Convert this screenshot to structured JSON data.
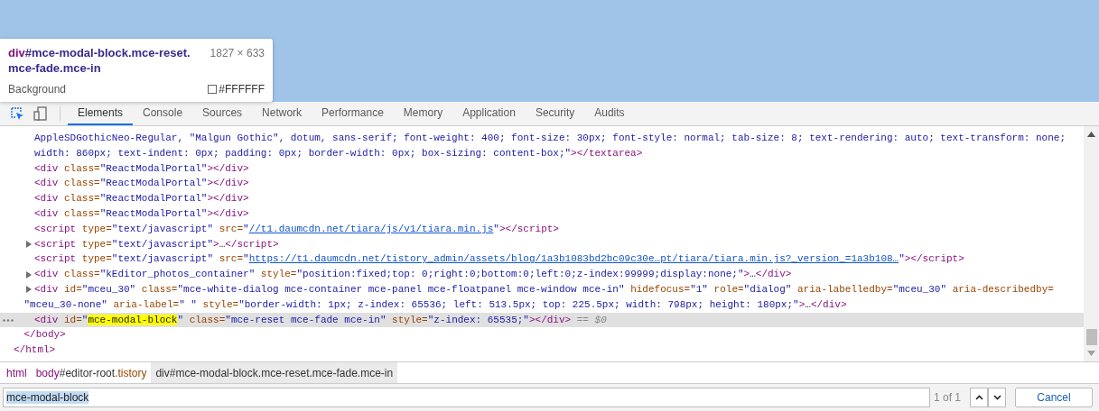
{
  "tooltip": {
    "title": [
      {
        "kind": "tag",
        "text": "div"
      },
      {
        "kind": "selector",
        "text": "#mce-modal-block.mce-reset."
      },
      {
        "kind": "break",
        "text": "mce-fade.mce-in"
      }
    ],
    "size": "1827 × 633",
    "property": "Background",
    "value": "#FFFFFF"
  },
  "toolbar": {
    "tools": [
      {
        "kind": "inspect",
        "selected": true
      },
      {
        "kind": "device",
        "selected": false
      }
    ],
    "tabs": [
      {
        "label": "Elements",
        "selected": true
      },
      {
        "label": "Console",
        "selected": false
      },
      {
        "label": "Sources",
        "selected": false
      },
      {
        "label": "Network",
        "selected": false
      },
      {
        "label": "Performance",
        "selected": false
      },
      {
        "label": "Memory",
        "selected": false
      },
      {
        "label": "Application",
        "selected": false
      },
      {
        "label": "Security",
        "selected": false
      },
      {
        "label": "Audits",
        "selected": false
      }
    ]
  },
  "dom_tree": {
    "children": [
      {
        "children": [
          {
            "kind": "leaf",
            "selected": false,
            "rows": [
              [
                {
                  "kind": "value",
                  "text": "AppleSDGothicNeo-Regular, \"Malgun Gothic\", dotum, sans-serif; font-weight: 400; font-size: 30px; font-style: normal; tab-size: 8; text-rendering: auto; text-transform: none;"
                }
              ],
              [
                {
                  "kind": "value",
                  "text": "width: 860px; text-indent: 0px; padding: 0px; border-width: 0px; box-sizing: content-box;\""
                },
                {
                  "kind": "tag",
                  "text": "></textarea>"
                }
              ]
            ]
          },
          {
            "kind": "leaf",
            "selected": false,
            "rows": [
              [
                {
                  "kind": "tag",
                  "text": "<div"
                },
                {
                  "kind": "attr",
                  "text": " class="
                },
                {
                  "kind": "value",
                  "text": "\"ReactModalPortal\""
                },
                {
                  "kind": "tag",
                  "text": "></div>"
                }
              ]
            ]
          },
          {
            "kind": "leaf",
            "selected": false,
            "rows": [
              [
                {
                  "kind": "tag",
                  "text": "<div"
                },
                {
                  "kind": "attr",
                  "text": " class="
                },
                {
                  "kind": "value",
                  "text": "\"ReactModalPortal\""
                },
                {
                  "kind": "tag",
                  "text": "></div>"
                }
              ]
            ]
          },
          {
            "kind": "leaf",
            "selected": false,
            "rows": [
              [
                {
                  "kind": "tag",
                  "text": "<div"
                },
                {
                  "kind": "attr",
                  "text": " class="
                },
                {
                  "kind": "value",
                  "text": "\"ReactModalPortal\""
                },
                {
                  "kind": "tag",
                  "text": "></div>"
                }
              ]
            ]
          },
          {
            "kind": "leaf",
            "selected": false,
            "rows": [
              [
                {
                  "kind": "tag",
                  "text": "<div"
                },
                {
                  "kind": "attr",
                  "text": " class="
                },
                {
                  "kind": "value",
                  "text": "\"ReactModalPortal\""
                },
                {
                  "kind": "tag",
                  "text": "></div>"
                }
              ]
            ]
          },
          {
            "kind": "leaf",
            "selected": false,
            "rows": [
              [
                {
                  "kind": "tag",
                  "text": "<script"
                },
                {
                  "kind": "attr",
                  "text": " type="
                },
                {
                  "kind": "value",
                  "text": "\"text/javascript\""
                },
                {
                  "kind": "attr",
                  "text": " src="
                },
                {
                  "kind": "value",
                  "text": "\""
                },
                {
                  "kind": "link",
                  "text": "//t1.daumcdn.net/tiara/js/v1/tiara.min.js"
                },
                {
                  "kind": "value",
                  "text": "\""
                },
                {
                  "kind": "tag",
                  "text": "></script>"
                }
              ]
            ]
          },
          {
            "kind": "collapsed",
            "selected": false,
            "rows": [
              [
                {
                  "kind": "tag",
                  "text": "<script"
                },
                {
                  "kind": "attr",
                  "text": " type="
                },
                {
                  "kind": "value",
                  "text": "\"text/javascript\""
                },
                {
                  "kind": "tag",
                  "text": ">"
                },
                {
                  "kind": "text",
                  "text": "…"
                },
                {
                  "kind": "tag",
                  "text": "</script>"
                }
              ]
            ]
          },
          {
            "kind": "leaf",
            "selected": false,
            "rows": [
              [
                {
                  "kind": "tag",
                  "text": "<script"
                },
                {
                  "kind": "attr",
                  "text": " type="
                },
                {
                  "kind": "value",
                  "text": "\"text/javascript\""
                },
                {
                  "kind": "attr",
                  "text": " src="
                },
                {
                  "kind": "value",
                  "text": "\""
                },
                {
                  "kind": "link",
                  "text": "https://t1.daumcdn.net/tistory_admin/assets/blog/1a3b1083bd2bc09c30e…pt/tiara/tiara.min.js?_version_=1a3b108…"
                },
                {
                  "kind": "value",
                  "text": "\""
                },
                {
                  "kind": "tag",
                  "text": "></script>"
                }
              ]
            ]
          },
          {
            "kind": "collapsed",
            "selected": false,
            "rows": [
              [
                {
                  "kind": "tag",
                  "text": "<div"
                },
                {
                  "kind": "attr",
                  "text": " class="
                },
                {
                  "kind": "value",
                  "text": "\"kEditor_photos_container\""
                },
                {
                  "kind": "attr",
                  "text": " style="
                },
                {
                  "kind": "value",
                  "text": "\"position:fixed;top: 0;right:0;bottom:0;left:0;z-index:99999;display:none;\""
                },
                {
                  "kind": "tag",
                  "text": ">"
                },
                {
                  "kind": "text",
                  "text": "…"
                },
                {
                  "kind": "tag",
                  "text": "</div>"
                }
              ]
            ]
          },
          {
            "kind": "collapsed",
            "selected": false,
            "rows": [
              {
                "tokens": [
                  {
                    "kind": "tag",
                    "text": "<div"
                  },
                  {
                    "kind": "attr",
                    "text": " id="
                  },
                  {
                    "kind": "value",
                    "text": "\"mceu_30\""
                  },
                  {
                    "kind": "attr",
                    "text": " class="
                  },
                  {
                    "kind": "value",
                    "text": "\"mce-white-dialog mce-container mce-panel mce-floatpanel mce-window mce-in\""
                  },
                  {
                    "kind": "attr",
                    "text": " hidefocus="
                  },
                  {
                    "kind": "value",
                    "text": "\"1\""
                  },
                  {
                    "kind": "attr",
                    "text": " role="
                  },
                  {
                    "kind": "value",
                    "text": "\"dialog\""
                  },
                  {
                    "kind": "attr",
                    "text": " aria-labelledby="
                  },
                  {
                    "kind": "value",
                    "text": "\"mceu_30\""
                  },
                  {
                    "kind": "attr",
                    "text": " aria-describedby="
                  }
                ]
              },
              {
                "tokens": [
                  {
                    "kind": "value",
                    "text": "\"mceu_30-none\""
                  },
                  {
                    "kind": "attr",
                    "text": " aria-label="
                  },
                  {
                    "kind": "value",
                    "text": "\" \""
                  },
                  {
                    "kind": "attr",
                    "text": " style="
                  },
                  {
                    "kind": "value",
                    "text": "\"border-width: 1px; z-index: 65536; left: 513.5px; top: 225.5px; width: 798px; height: 180px;\""
                  },
                  {
                    "kind": "tag",
                    "text": ">"
                  },
                  {
                    "kind": "text",
                    "text": "…"
                  },
                  {
                    "kind": "tag",
                    "text": "</div>"
                  }
                ]
              }
            ]
          },
          {
            "kind": "leaf",
            "selected": true,
            "rows": [
              [
                {
                  "kind": "tag",
                  "text": "<div"
                },
                {
                  "kind": "attr",
                  "text": " id="
                },
                {
                  "kind": "value",
                  "text": "\""
                },
                {
                  "kind": "match",
                  "text": "mce-modal-block"
                },
                {
                  "kind": "value",
                  "text": "\""
                },
                {
                  "kind": "attr",
                  "text": " class="
                },
                {
                  "kind": "value",
                  "text": "\"mce-reset mce-fade mce-in\""
                },
                {
                  "kind": "attr",
                  "text": " style="
                },
                {
                  "kind": "value",
                  "text": "\"z-index: 65535;\""
                },
                {
                  "kind": "tag",
                  "text": "></div>"
                },
                {
                  "kind": "ref",
                  "text": " == $0"
                }
              ]
            ]
          }
        ],
        "closing": [
          {
            "kind": "tag",
            "text": "</body>"
          }
        ]
      }
    ],
    "closing": [
      {
        "kind": "tag",
        "text": "</html>"
      }
    ]
  },
  "breadcrumbs": [
    {
      "selected": false,
      "parts": [
        {
          "kind": "tag",
          "text": "html"
        }
      ]
    },
    {
      "selected": false,
      "parts": [
        {
          "kind": "tag",
          "text": "body"
        },
        {
          "kind": "id",
          "text": "#editor-root"
        },
        {
          "kind": "class",
          "text": ".tistory"
        }
      ]
    },
    {
      "selected": true,
      "parts": [
        {
          "kind": "id",
          "text": "div#mce-modal-block.mce-reset.mce-fade.mce-in"
        }
      ]
    }
  ],
  "search": {
    "value": "mce-modal-block",
    "count": "1 of 1",
    "cancel": "Cancel"
  }
}
